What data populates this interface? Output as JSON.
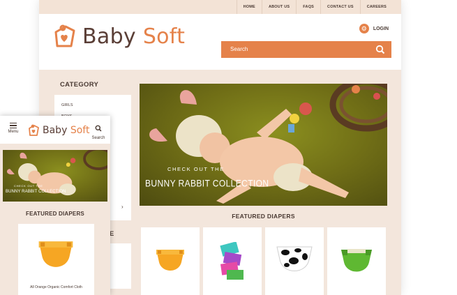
{
  "desktop": {
    "topnav": [
      "HOME",
      "ABOUT US",
      "FAQS",
      "CONTACT US",
      "CAREERS"
    ],
    "brand": {
      "part1": "Baby",
      "part2": "Soft"
    },
    "login_label": "LOGIN",
    "search_placeholder": "Search",
    "category_title": "CATEGORY",
    "categories": [
      "GIRLS",
      "BOYS"
    ],
    "hero": {
      "line1": "CHECK OUT THE",
      "line2": "BUNNY RABBIT COLLECTION"
    },
    "featured_title": "FEATURED DIAPERS",
    "second_panel_title_fragment": "CE"
  },
  "mobile": {
    "menu_label": "Menu",
    "search_label": "Search",
    "brand": {
      "part1": "Baby",
      "part2": "Soft"
    },
    "hero": {
      "line1": "CHECK OUT THE",
      "line2": "BUNNY RABBIT COLLECTION"
    },
    "featured_title": "FEATURED DIAPERS",
    "product_name": "All Orange Organic Comfort Cloth"
  },
  "colors": {
    "accent": "#e5824a",
    "brand_dark": "#5a3e36",
    "page_bg": "#f3e6dc"
  },
  "icons": [
    "logo-icon",
    "gear-icon",
    "search-icon",
    "menu-icon",
    "chevron-right-icon"
  ]
}
